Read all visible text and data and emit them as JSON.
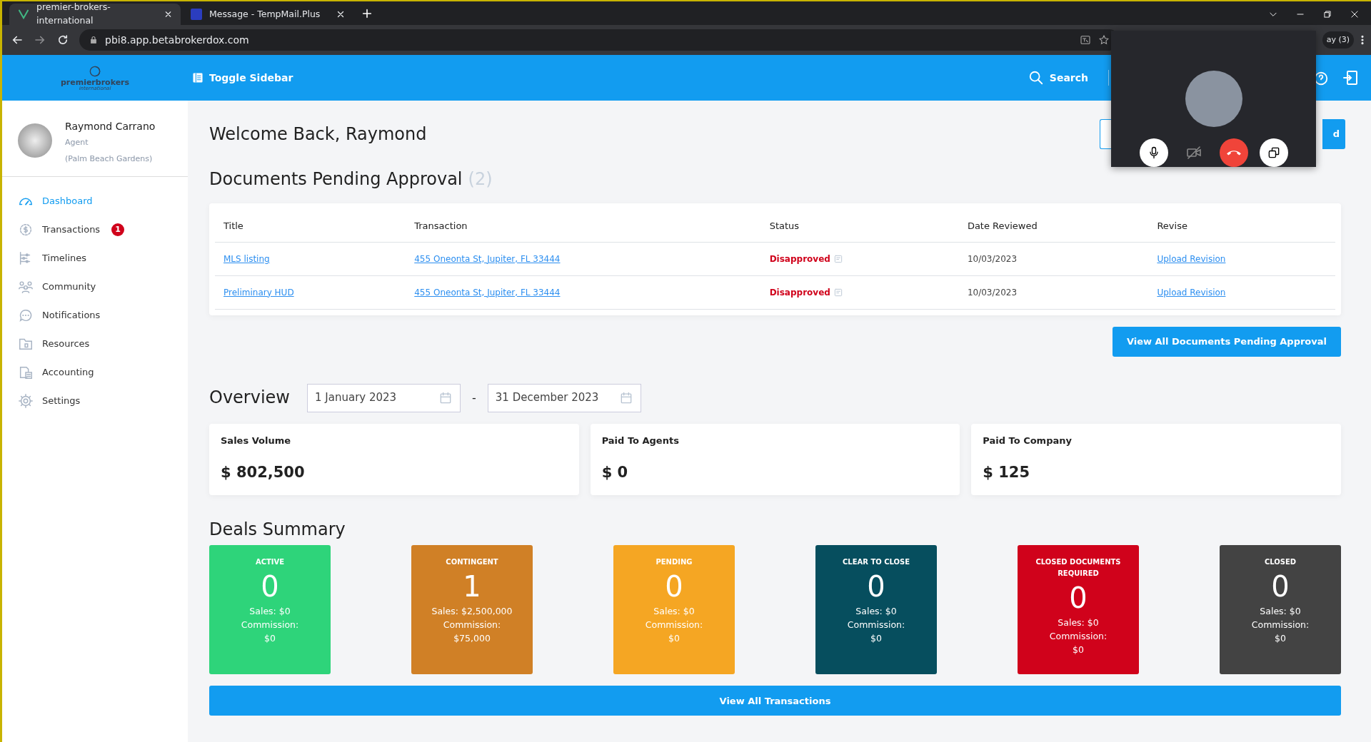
{
  "browser": {
    "tabs": [
      {
        "title": "premier-brokers-international",
        "selected": true
      },
      {
        "title": "Message - TempMail.Plus",
        "selected": false
      }
    ],
    "url": "pbi8.app.betabrokerdox.com",
    "profile_chip": "ay (3)"
  },
  "header": {
    "logo_text": "premierbrokers",
    "logo_subtext": "international",
    "toggle": "Toggle Sidebar",
    "search": "Search"
  },
  "user": {
    "name": "Raymond Carrano",
    "role": "Agent",
    "office": "(Palm Beach Gardens)"
  },
  "sidebar": {
    "items": [
      {
        "label": "Dashboard",
        "selected": true
      },
      {
        "label": "Transactions",
        "selected": false,
        "badge": "1"
      },
      {
        "label": "Timelines",
        "selected": false
      },
      {
        "label": "Community",
        "selected": false
      },
      {
        "label": "Notifications",
        "selected": false
      },
      {
        "label": "Resources",
        "selected": false
      },
      {
        "label": "Accounting",
        "selected": false
      },
      {
        "label": "Settings",
        "selected": false
      }
    ]
  },
  "welcome": "Welcome Back, Raymond",
  "top_button_label": "d",
  "pending": {
    "title": "Documents Pending Approval",
    "count": "(2)",
    "columns": [
      "Title",
      "Transaction",
      "Status",
      "Date Reviewed",
      "Revise"
    ],
    "rows": [
      {
        "title": "MLS listing",
        "transaction": "455 Oneonta St, Jupiter, FL 33444",
        "status": "Disapproved",
        "date": "10/03/2023",
        "action": "Upload Revision"
      },
      {
        "title": "Preliminary HUD",
        "transaction": "455 Oneonta St, Jupiter, FL 33444",
        "status": "Disapproved",
        "date": "10/03/2023",
        "action": "Upload Revision"
      }
    ],
    "button": "View All Documents Pending Approval"
  },
  "overview": {
    "title": "Overview",
    "from": "1 January 2023",
    "separator": "-",
    "to": "31 December 2023",
    "stats": [
      {
        "label": "Sales Volume",
        "value": "$ 802,500"
      },
      {
        "label": "Paid To Agents",
        "value": "$ 0"
      },
      {
        "label": "Paid To Company",
        "value": "$ 125"
      }
    ]
  },
  "deals": {
    "title": "Deals Summary",
    "button": "View All Transactions",
    "cards": [
      {
        "label": "ACTIVE",
        "count": "0",
        "sales": "Sales: $0",
        "commission": "Commission:",
        "commission_value": "$0",
        "color": "#2ed47a"
      },
      {
        "label": "CONTINGENT",
        "count": "1",
        "sales": "Sales: $2,500,000",
        "commission": "Commission:",
        "commission_value": "$75,000",
        "color": "#d08026"
      },
      {
        "label": "PENDING",
        "count": "0",
        "sales": "Sales: $0",
        "commission": "Commission:",
        "commission_value": "$0",
        "color": "#f5a623"
      },
      {
        "label": "CLEAR TO CLOSE",
        "count": "0",
        "sales": "Sales: $0",
        "commission": "Commission:",
        "commission_value": "$0",
        "color": "#064e5e"
      },
      {
        "label": "CLOSED DOCUMENTS REQUIRED",
        "count": "0",
        "sales": "Sales: $0",
        "commission": "Commission:",
        "commission_value": "$0",
        "color": "#d0021b"
      },
      {
        "label": "CLOSED",
        "count": "0",
        "sales": "Sales: $0",
        "commission": "Commission:",
        "commission_value": "$0",
        "color": "#434343"
      }
    ]
  },
  "call": {
    "muted": false,
    "camera_on": false
  }
}
